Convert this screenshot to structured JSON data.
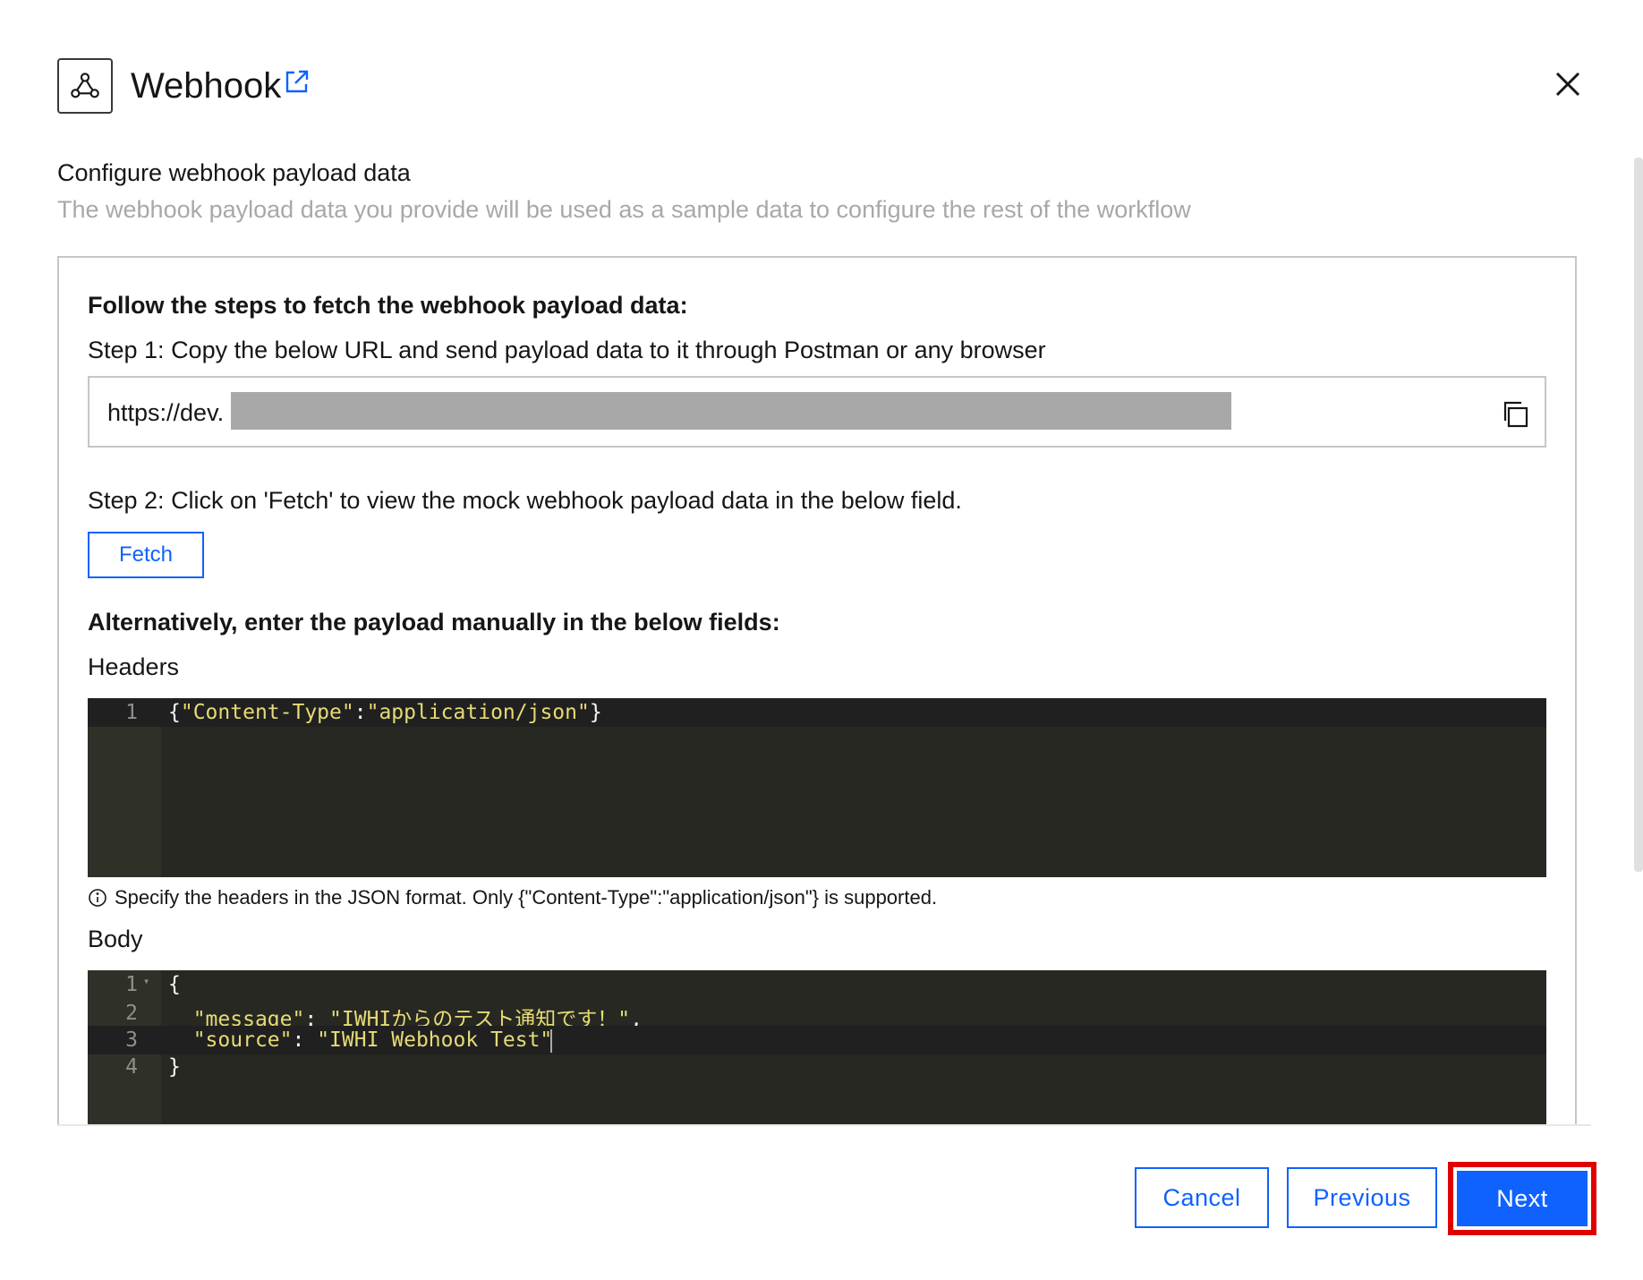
{
  "header": {
    "title": "Webhook"
  },
  "section": {
    "title": "Configure webhook payload data",
    "description": "The webhook payload data you provide will be used as a sample data to configure the rest of the workflow"
  },
  "steps": {
    "title": "Follow the steps to fetch the webhook payload data:",
    "step1": "Step 1: Copy the below URL and send payload data to it through Postman or any browser",
    "url_visible": "https://dev.",
    "step2": "Step 2: Click on 'Fetch' to view the mock webhook payload data in the below field.",
    "fetch_label": "Fetch"
  },
  "manual": {
    "title": "Alternatively, enter the payload manually in the below fields:",
    "headers_label": "Headers",
    "headers_lines": [
      {
        "num": "1",
        "parts": [
          {
            "t": "{",
            "c": "p"
          },
          {
            "t": "\"Content-Type\"",
            "c": "s"
          },
          {
            "t": ":",
            "c": "p"
          },
          {
            "t": "\"application/json\"",
            "c": "s"
          },
          {
            "t": "}",
            "c": "p"
          }
        ]
      }
    ],
    "helper_text": "Specify the headers in the JSON format. Only {\"Content-Type\":\"application/json\"} is supported.",
    "body_label": "Body",
    "body_lines": [
      {
        "num": "1",
        "parts": [
          {
            "t": "{",
            "c": "p"
          }
        ]
      },
      {
        "num": "2",
        "parts": [
          {
            "t": "  ",
            "c": "p"
          },
          {
            "t": "\"message\"",
            "c": "s"
          },
          {
            "t": ": ",
            "c": "p"
          },
          {
            "t": "\"IWHIからのテスト通知です！\"",
            "c": "s"
          },
          {
            "t": ",",
            "c": "p"
          }
        ]
      },
      {
        "num": "3",
        "parts": [
          {
            "t": "  ",
            "c": "p"
          },
          {
            "t": "\"source\"",
            "c": "s"
          },
          {
            "t": ": ",
            "c": "p"
          },
          {
            "t": "\"IWHI Webhook Test\"",
            "c": "s"
          }
        ]
      },
      {
        "num": "4",
        "parts": [
          {
            "t": "}",
            "c": "p"
          }
        ]
      }
    ]
  },
  "footer": {
    "cancel_label": "Cancel",
    "previous_label": "Previous",
    "next_label": "Next"
  },
  "colors": {
    "primary": "#0f62fe",
    "editor_bg": "#272822",
    "editor_string": "#e6db74",
    "highlight": "#e00000"
  },
  "icons": [
    "webhook-icon",
    "launch-icon",
    "close-icon",
    "copy-icon",
    "info-icon",
    "fold-arrow-icon"
  ]
}
